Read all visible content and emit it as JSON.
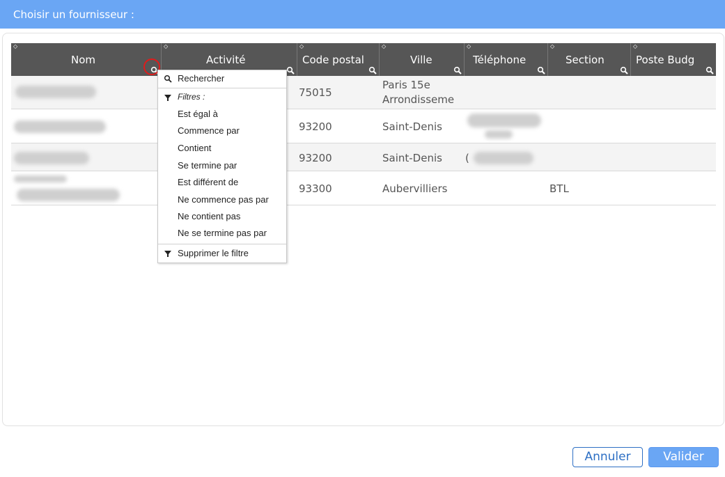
{
  "dialog": {
    "title": "Choisir un fournisseur :"
  },
  "grid": {
    "columns": [
      {
        "label": "Nom"
      },
      {
        "label": "Activité"
      },
      {
        "label": "Code postal"
      },
      {
        "label": "Ville"
      },
      {
        "label": "Téléphone"
      },
      {
        "label": "Section"
      },
      {
        "label": "Poste Budg"
      }
    ],
    "rows": [
      {
        "code_postal": "75015",
        "ville_line1": "Paris 15e",
        "ville_line2": "Arrondisseme",
        "section": ""
      },
      {
        "code_postal": "93200",
        "ville_line1": "Saint-Denis",
        "ville_line2": "",
        "section": ""
      },
      {
        "code_postal": "93200",
        "ville_line1": "Saint-Denis",
        "ville_line2": "",
        "section": "",
        "telephone_prefix": "("
      },
      {
        "code_postal": "93300",
        "ville_line1": "Aubervilliers",
        "ville_line2": "",
        "section": "BTL"
      }
    ]
  },
  "filter_menu": {
    "search": "Rechercher",
    "filters_header": "Filtres :",
    "options": [
      "Est égal à",
      "Commence par",
      "Contient",
      "Se termine par",
      "Est différent de",
      "Ne commence pas par",
      "Ne contient pas",
      "Ne se termine pas par"
    ],
    "remove": "Supprimer le filtre"
  },
  "buttons": {
    "cancel": "Annuler",
    "ok": "Valider"
  },
  "colors": {
    "title_bar": "#6aa6f4",
    "header": "#565656",
    "highlight_circle": "#e01b1b"
  }
}
